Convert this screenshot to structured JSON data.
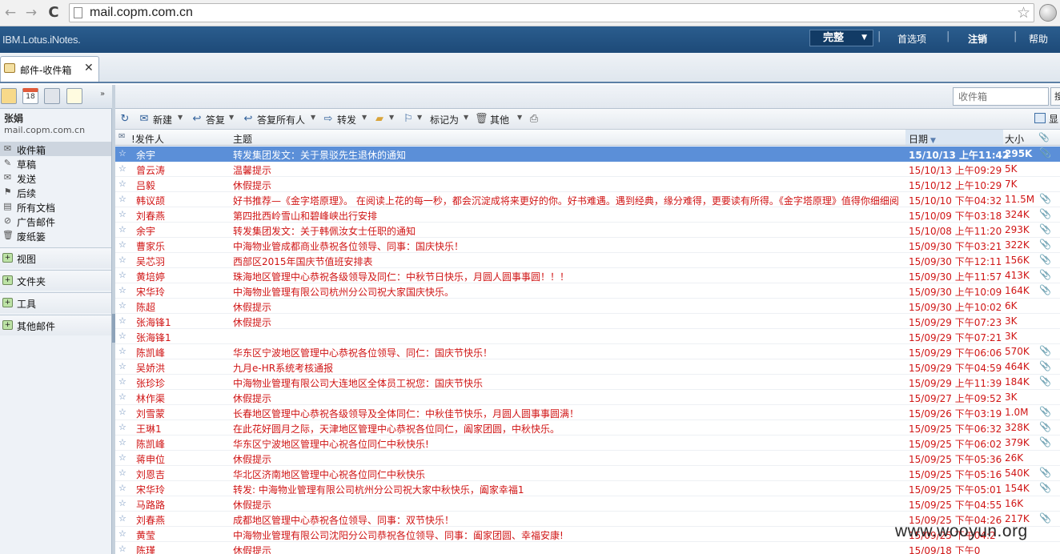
{
  "browser": {
    "url": "mail.copm.com.cn",
    "back_glyph": "←",
    "forward_glyph": "→",
    "reload_glyph": "C",
    "star_glyph": "☆"
  },
  "header": {
    "brand": "IBM.Lotus.iNotes.",
    "view_mode": "完整",
    "view_mode_caret": "▼",
    "separator": "|",
    "links": {
      "preferences": "首选项",
      "logout": "注销",
      "help": "帮助"
    }
  },
  "tab": {
    "label": "邮件-收件箱",
    "close": "✕"
  },
  "sidebar": {
    "tool_more": "»",
    "calendar_day": "18",
    "user_name": "张娟",
    "user_domain": "mail.copm.com.cn",
    "folders": [
      {
        "label": "收件箱",
        "icon": "inbox-icon",
        "glyph": "✉",
        "selected": true
      },
      {
        "label": "草稿",
        "icon": "drafts-icon",
        "glyph": "✎",
        "selected": false
      },
      {
        "label": "发送",
        "icon": "sent-icon",
        "glyph": "✉",
        "selected": false
      },
      {
        "label": "后续",
        "icon": "follow-up-icon",
        "glyph": "⚑",
        "selected": false
      },
      {
        "label": "所有文档",
        "icon": "all-documents-icon",
        "glyph": "▤",
        "selected": false
      },
      {
        "label": "广告邮件",
        "icon": "junk-mail-icon",
        "glyph": "⊘",
        "selected": false
      },
      {
        "label": "废纸篓",
        "icon": "trash-icon",
        "glyph": "🗑",
        "selected": false
      }
    ],
    "sections": [
      "视图",
      "文件夹",
      "工具",
      "其他邮件"
    ]
  },
  "search": {
    "placeholder": "收件箱",
    "button": "搜"
  },
  "toolbar": {
    "new": "新建",
    "reply": "答复",
    "reply_all": "答复所有人",
    "forward": "转发",
    "mark_as": "标记为",
    "other": "其他",
    "show": "显",
    "caret": "▼"
  },
  "columns": {
    "sender": "发件人",
    "subject": "主题",
    "date": "日期",
    "size": "大小",
    "sort_indicator": "▼",
    "attachment": "📎"
  },
  "colors": {
    "header_bg": "#2b5d8e",
    "unread_text": "#d01515",
    "selected_row": "#5b8fd8"
  },
  "messages": [
    {
      "sender": "余宇",
      "subject": "转发集团发文：关于景驳先生退休的通知",
      "date": "15/10/13 上午11:42",
      "size": "295K",
      "attachment": true,
      "selected": true
    },
    {
      "sender": "曾云涛",
      "subject": "温馨提示",
      "date": "15/10/13 上午09:29",
      "size": "5K",
      "attachment": false
    },
    {
      "sender": "吕毅",
      "subject": "休假提示",
      "date": "15/10/12 上午10:29",
      "size": "7K",
      "attachment": false
    },
    {
      "sender": "韩议颉",
      "subject": "好书推荐—《金字塔原理》。 在阅读上花的每一秒，都会沉淀成将来更好的你。好书难遇。遇到经典，缘分难得，更要读有所得。《金字塔原理》值得你细细阅",
      "date": "15/10/10 下午04:32",
      "size": "11.5M",
      "attachment": true
    },
    {
      "sender": "刘春燕",
      "subject": " 第四批西岭雪山和碧峰峡出行安排",
      "date": "15/10/09 下午03:18",
      "size": "324K",
      "attachment": true
    },
    {
      "sender": "余宇",
      "subject": "转发集团发文：关于韩佩汝女士任职的通知",
      "date": "15/10/08 上午11:20",
      "size": "293K",
      "attachment": true
    },
    {
      "sender": "曹家乐",
      "subject": "中海物业管成都商业恭祝各位领导、同事：国庆快乐！",
      "date": "15/09/30 下午03:21",
      "size": "322K",
      "attachment": true
    },
    {
      "sender": "吴芯羽",
      "subject": "西部区2015年国庆节值班安排表",
      "date": "15/09/30 下午12:11",
      "size": "156K",
      "attachment": true
    },
    {
      "sender": "黄培婷",
      "subject": "珠海地区管理中心恭祝各级领导及同仁：中秋节日快乐，月圆人圆事事圆！！！",
      "date": "15/09/30 上午11:57",
      "size": "413K",
      "attachment": true
    },
    {
      "sender": "宋华玲",
      "subject": "中海物业管理有限公司杭州分公司祝大家国庆快乐。",
      "date": "15/09/30 上午10:09",
      "size": "164K",
      "attachment": true
    },
    {
      "sender": "陈超",
      "subject": "休假提示",
      "date": "15/09/30 上午10:02",
      "size": "6K",
      "attachment": false
    },
    {
      "sender": "张海锋1",
      "subject": "休假提示",
      "date": "15/09/29 下午07:23",
      "size": "3K",
      "attachment": false
    },
    {
      "sender": "张海锋1",
      "subject": "",
      "date": "15/09/29 下午07:21",
      "size": "3K",
      "attachment": false
    },
    {
      "sender": "陈凯峰",
      "subject": "华东区宁波地区管理中心恭祝各位领导、同仁：国庆节快乐！",
      "date": "15/09/29 下午06:06",
      "size": "570K",
      "attachment": true
    },
    {
      "sender": "吴娇洪",
      "subject": "九月e-HR系统考核通报",
      "date": "15/09/29 下午04:59",
      "size": "464K",
      "attachment": true
    },
    {
      "sender": "张珍珍",
      "subject": "中海物业管理有限公司大连地区全体员工祝您：国庆节快乐",
      "date": "15/09/29 上午11:39",
      "size": "184K",
      "attachment": true
    },
    {
      "sender": "林作渠",
      "subject": "休假提示",
      "date": "15/09/27 上午09:52",
      "size": "3K",
      "attachment": false
    },
    {
      "sender": "刘雪蒙",
      "subject": "长春地区管理中心恭祝各级领导及全体同仁：中秋佳节快乐，月圆人圆事事圆满！",
      "date": "15/09/26 下午03:19",
      "size": "1.0M",
      "attachment": true
    },
    {
      "sender": "王琳1",
      "subject": "在此花好圆月之际，天津地区管理中心恭祝各位同仁，阖家团圆，中秋快乐。",
      "date": "15/09/25 下午06:32",
      "size": "328K",
      "attachment": true
    },
    {
      "sender": "陈凯峰",
      "subject": "华东区宁波地区管理中心祝各位同仁中秋快乐!",
      "date": "15/09/25 下午06:02",
      "size": "379K",
      "attachment": true
    },
    {
      "sender": "蒋申位",
      "subject": "休假提示",
      "date": "15/09/25 下午05:36",
      "size": "26K",
      "attachment": false
    },
    {
      "sender": "刘恩吉",
      "subject": "华北区济南地区管理中心祝各位同仁中秋快乐",
      "date": "15/09/25 下午05:16",
      "size": "540K",
      "attachment": true
    },
    {
      "sender": "宋华玲",
      "subject": "转发: 中海物业管理有限公司杭州分公司祝大家中秋快乐，阖家幸福1",
      "date": "15/09/25 下午05:01",
      "size": "154K",
      "attachment": true
    },
    {
      "sender": "马路路",
      "subject": "休假提示",
      "date": "15/09/25 下午04:55",
      "size": "16K",
      "attachment": false
    },
    {
      "sender": "刘春燕",
      "subject": "成都地区管理中心恭祝各位领导、同事：双节快乐！",
      "date": "15/09/25 下午04:26",
      "size": "217K",
      "attachment": true
    },
    {
      "sender": "黄莹",
      "subject": "中海物业管理有限公司沈阳分公司恭祝各位领导、同事：阖家团圆、幸福安康!",
      "date": "15/09/25 下午04:2",
      "size": "",
      "attachment": false
    },
    {
      "sender": "陈瑾",
      "subject": "休假提示",
      "date": "15/09/18 下午0",
      "size": "",
      "attachment": false
    }
  ],
  "watermark": "www.wooyun.org"
}
